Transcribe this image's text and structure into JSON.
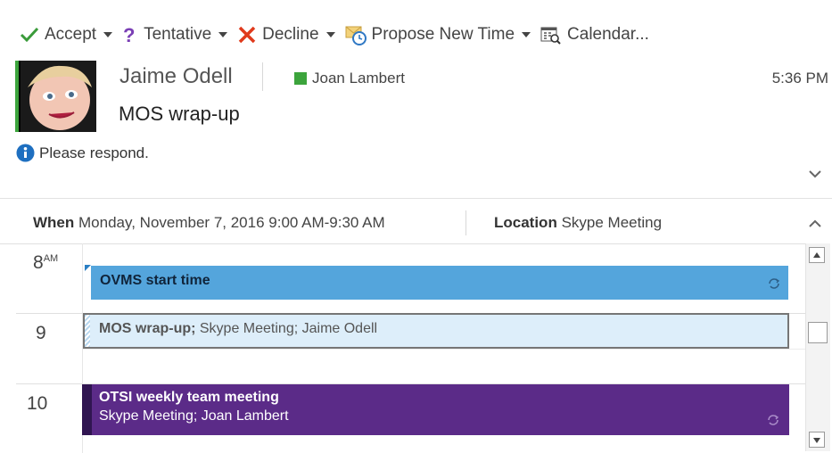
{
  "toolbar": {
    "accept_label": "Accept",
    "tentative_label": "Tentative",
    "decline_label": "Decline",
    "propose_label": "Propose New Time",
    "calendar_label": "Calendar..."
  },
  "header": {
    "sender": "Jaime Odell",
    "attendee": "Joan Lambert",
    "time": "5:36 PM",
    "subject": "MOS wrap-up"
  },
  "info": {
    "text": "Please respond."
  },
  "details": {
    "when_label": "When",
    "when_value": "Monday, November 7, 2016 9:00 AM-9:30 AM",
    "location_label": "Location",
    "location_value": "Skype Meeting"
  },
  "calendar": {
    "hours": [
      {
        "hour": "8",
        "suffix": "AM"
      },
      {
        "hour": "9",
        "suffix": ""
      },
      {
        "hour": "10",
        "suffix": ""
      }
    ],
    "events": [
      {
        "title": "OVMS start time"
      },
      {
        "title": "MOS wrap-up;",
        "detail": " Skype Meeting; Jaime Odell"
      },
      {
        "title": "OTSI weekly team meeting",
        "detail": "Skype Meeting; Joan Lambert"
      }
    ]
  },
  "colors": {
    "accept_green": "#3a9b3a",
    "tentative_purple": "#7a3fb5",
    "decline_red": "#e03a1c",
    "event_blue": "#54a5dc",
    "event_purple": "#5b2b88",
    "attendee_green": "#3ca43c"
  }
}
